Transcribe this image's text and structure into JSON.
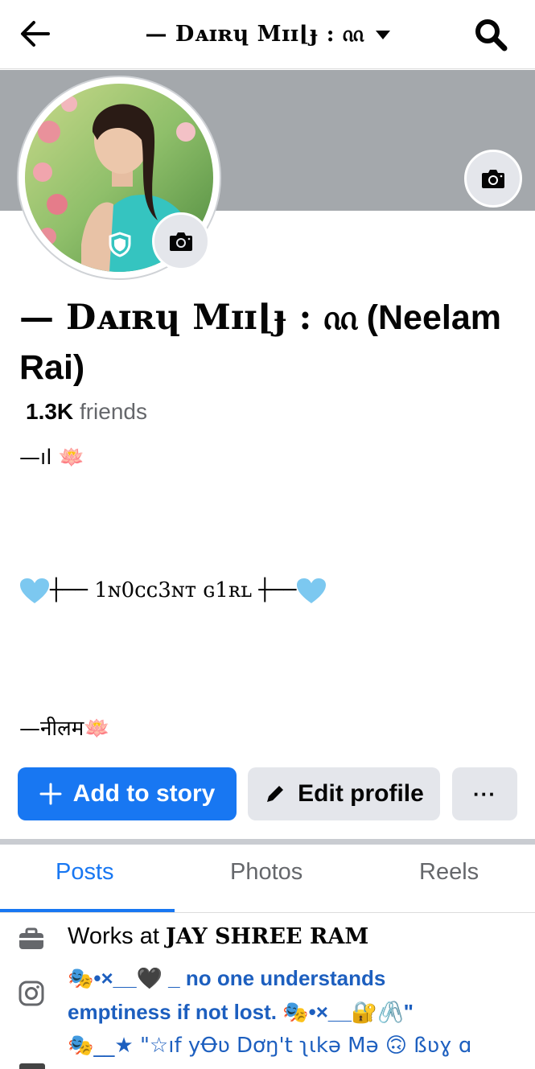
{
  "header": {
    "title": "— Dᴀɪʀɥ Mɪɪ⌊ɟ : ᦶ",
    "back_icon": "arrow-left-icon",
    "search_icon": "search-icon",
    "dropdown_icon": "caret-down-icon"
  },
  "profile": {
    "name_fancy": "— Dᴀɪʀɥ Mɪɪ⌊ɟ : ᦶ",
    "name_real": "(Neelam Rai)",
    "friends_count": "1.3K",
    "friends_label": "friends"
  },
  "bio": {
    "line1": "—ıl 🪷",
    "line2_text": "┼── 1ɴ0ᴄᴄ3ɴᴛ ɢ1ʀʟ ┼──",
    "line3": "—नीलम🪷"
  },
  "actions": {
    "add_story": "Add to story",
    "edit_profile": "Edit profile",
    "more": "···"
  },
  "tabs": [
    {
      "label": "Posts",
      "active": true
    },
    {
      "label": "Photos",
      "active": false
    },
    {
      "label": "Reels",
      "active": false
    }
  ],
  "details": {
    "work_prefix": "Works at",
    "work_place": "JAY  SHREE RAM",
    "instagram_line1": "🎭•×__🖤  _ no one understands",
    "instagram_line2": "emptiness if not lost.  🎭•×__🔐🖇️\"",
    "instagram_line3": "🎭__★  \"☆ıf yꝊʋ Dơŋ't ʅɩkə Mə 🙃 ßʋɣ ɑ"
  },
  "colors": {
    "accent": "#1877f2",
    "cover": "#a4a8ac",
    "button_gray": "#e4e6eb",
    "secondary_text": "#65676b"
  }
}
